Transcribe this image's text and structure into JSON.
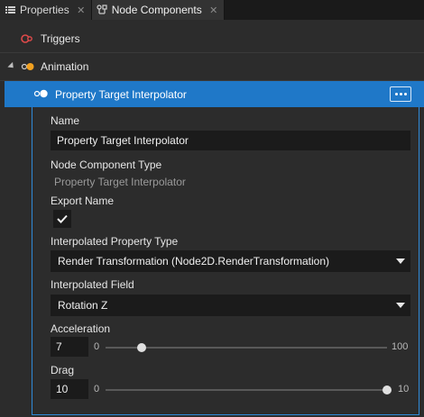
{
  "tabs": [
    {
      "label": "Properties",
      "icon": "list-icon"
    },
    {
      "label": "Node Components",
      "icon": "node-components-icon"
    }
  ],
  "tree": {
    "triggers_label": "Triggers",
    "animation_label": "Animation",
    "selected_label": "Property Target Interpolator"
  },
  "properties": {
    "name_label": "Name",
    "name_value": "Property Target Interpolator",
    "type_label": "Node Component Type",
    "type_value": "Property Target Interpolator",
    "export_label": "Export Name",
    "export_checked": true,
    "interp_type_label": "Interpolated Property Type",
    "interp_type_value": "Render Transformation (Node2D.RenderTransformation)",
    "interp_field_label": "Interpolated Field",
    "interp_field_value": "Rotation Z",
    "acceleration": {
      "label": "Acceleration",
      "value": "7",
      "min": "0",
      "max": "100",
      "fraction": 0.07
    },
    "drag": {
      "label": "Drag",
      "value": "10",
      "min": "0",
      "max": "10",
      "fraction": 1.0
    }
  },
  "colors": {
    "selection": "#1f78c8",
    "panel": "#2c2c2c",
    "field": "#1b1b1b",
    "trigger_icon": "#e04a4a",
    "animation_icon": "#f0a020"
  }
}
